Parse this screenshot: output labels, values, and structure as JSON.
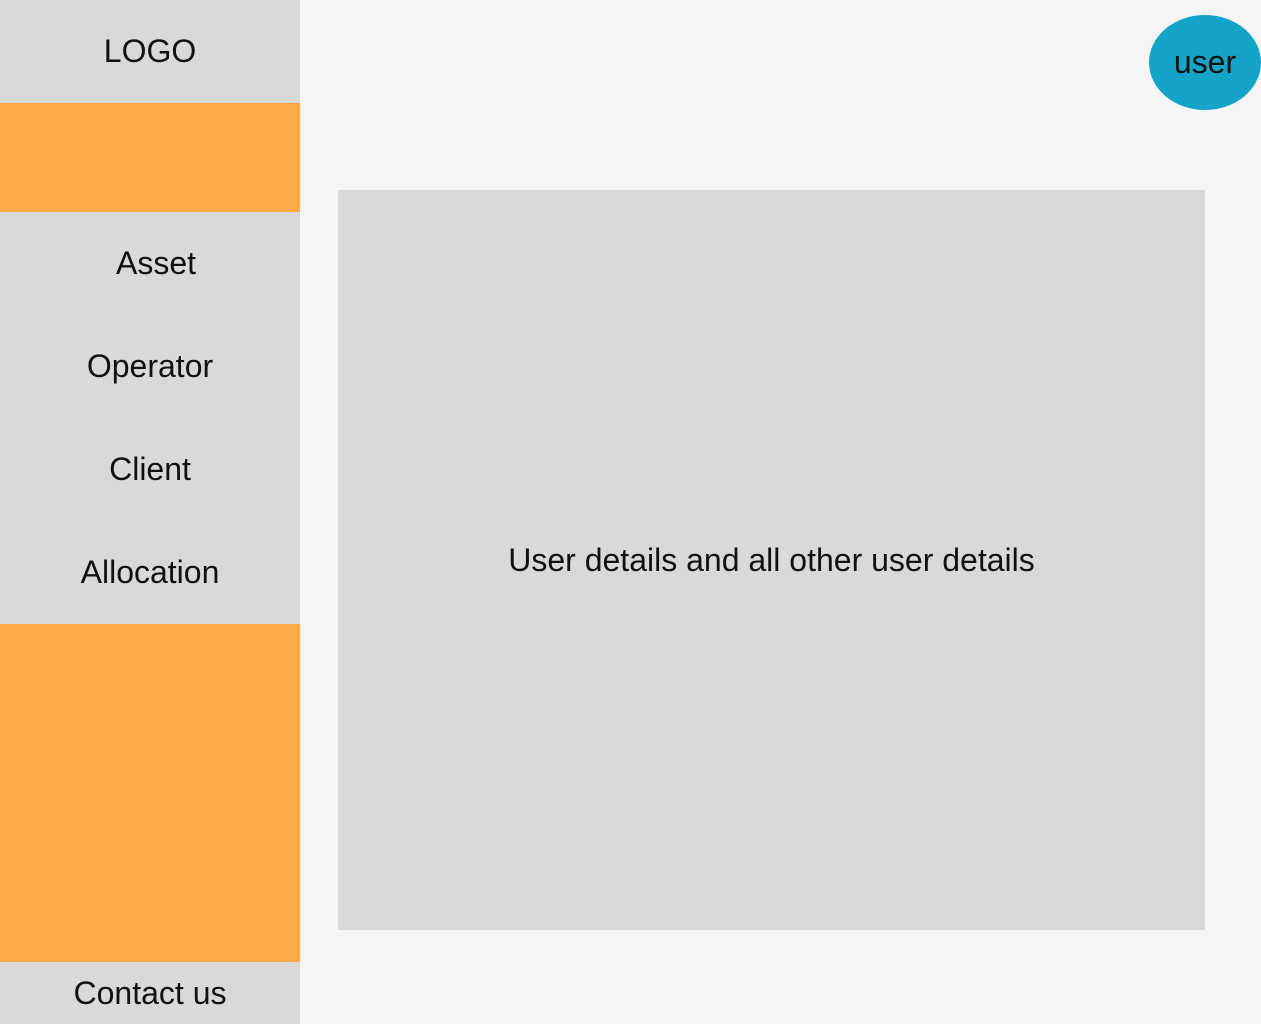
{
  "sidebar": {
    "logo": "LOGO",
    "items": [
      {
        "label": "Asset"
      },
      {
        "label": "Operator"
      },
      {
        "label": "Client"
      },
      {
        "label": "Allocation"
      }
    ],
    "contact": "Contact us"
  },
  "header": {
    "user": "user"
  },
  "main": {
    "details": "User details and all other user details"
  },
  "colors": {
    "accent": "#ffaa4a",
    "avatar": "#14a4c8",
    "panel": "#d9d9d9",
    "background": "#f5f5f5"
  }
}
